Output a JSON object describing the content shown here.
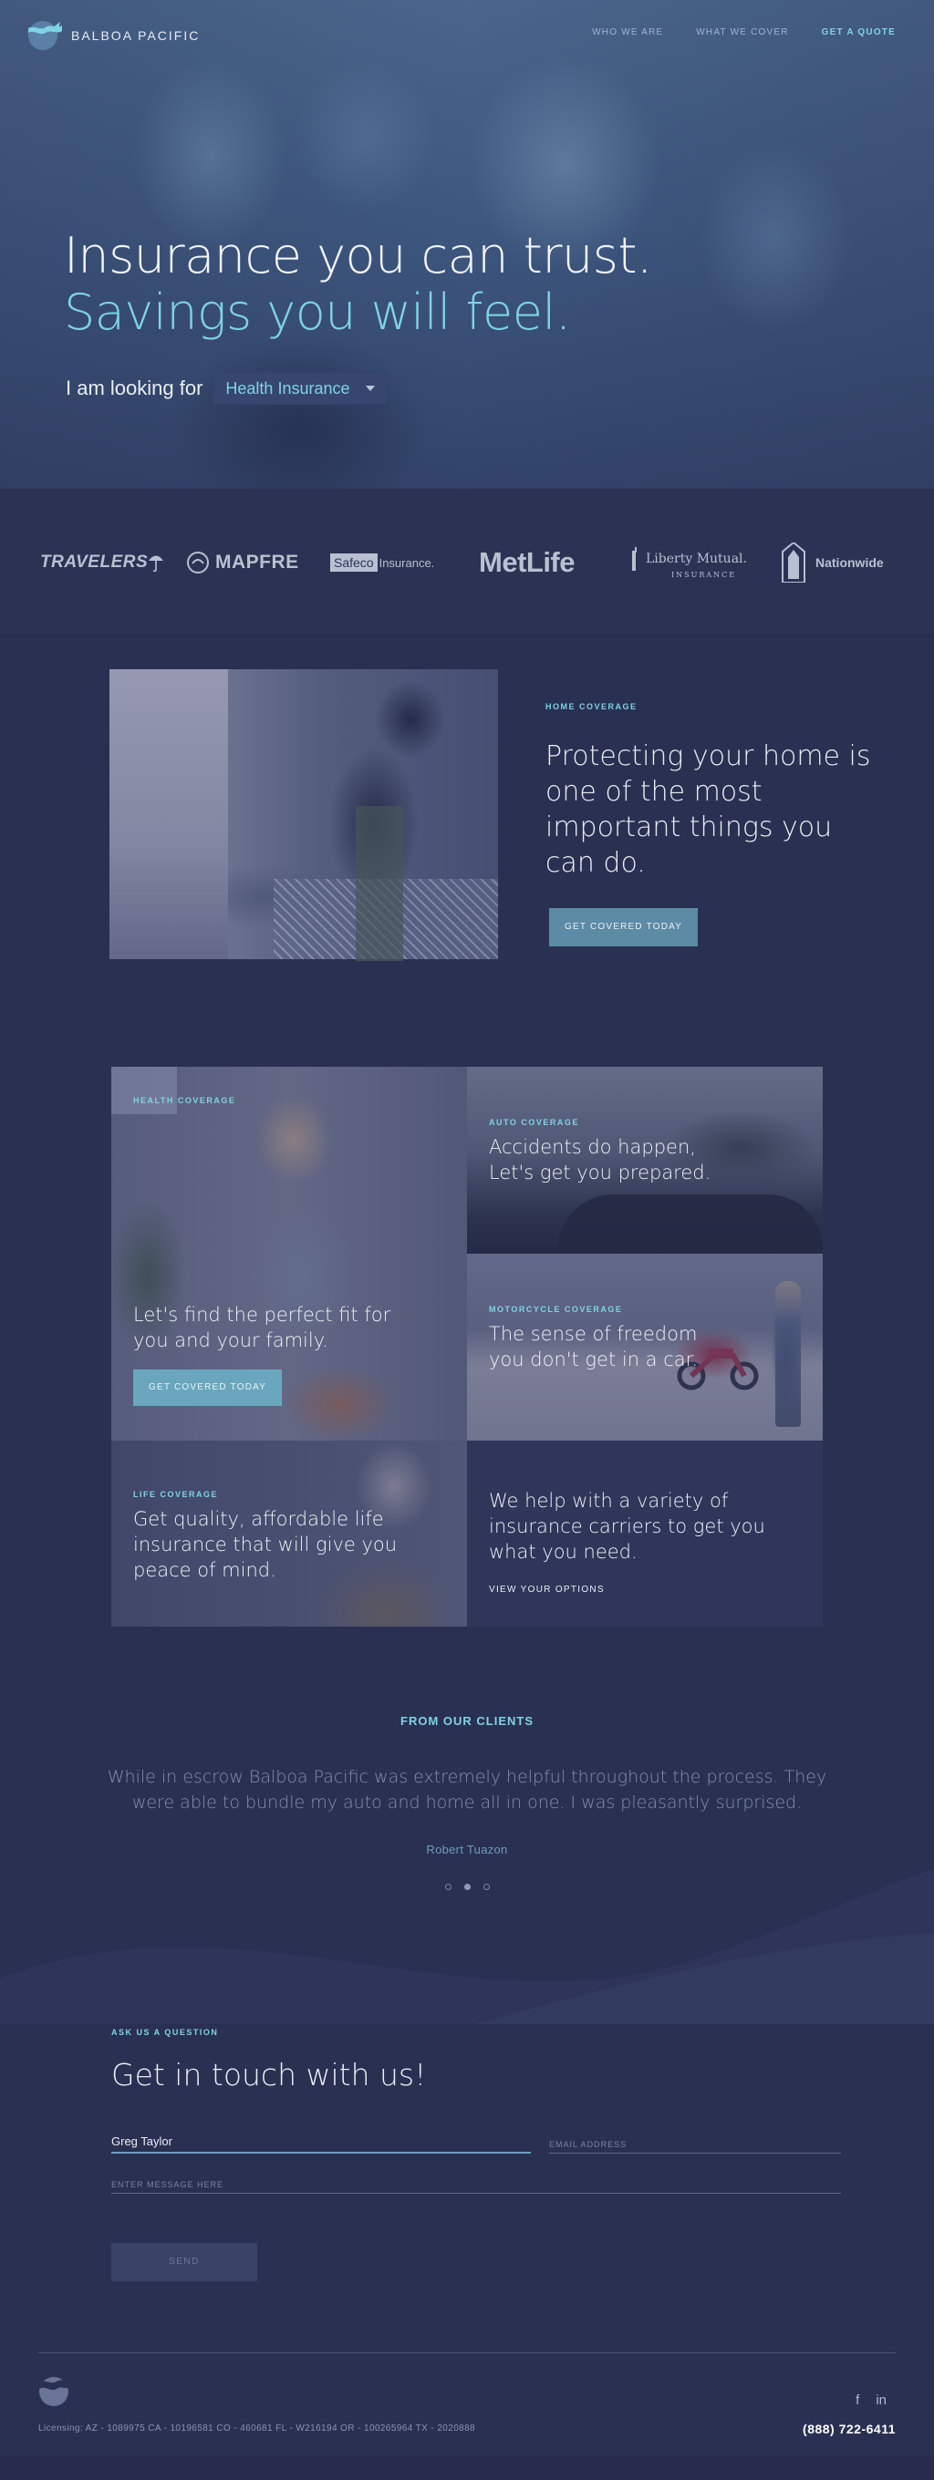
{
  "brand": {
    "name": "BALBOA PACIFIC",
    "accent": "#7fd3e4",
    "background": "#2a3051"
  },
  "nav": {
    "links": [
      {
        "label": "WHO WE ARE"
      },
      {
        "label": "WHAT WE COVER"
      },
      {
        "label": "GET A QUOTE"
      }
    ]
  },
  "hero": {
    "line1": "Insurance you can trust.",
    "line2": "Savings you will feel.",
    "looking_label": "I am looking for",
    "select_value": "Health Insurance"
  },
  "partners": {
    "travelers": "TRAVELERS",
    "mapfre": "MAPFRE",
    "safeco_box": "Safeco",
    "safeco_text": "Insurance.",
    "metlife": "MetLife",
    "liberty": "Liberty Mutual.",
    "liberty_sub": "INSURANCE",
    "nationwide": "Nationwide"
  },
  "home": {
    "eyebrow": "HOME COVERAGE",
    "title": "Protecting your home is one of the most important things you can do.",
    "button": "GET COVERED TODAY"
  },
  "coverage": {
    "health": {
      "eyebrow": "HEALTH COVERAGE",
      "title": "Let's find the perfect fit for you and your family.",
      "button": "GET COVERED TODAY"
    },
    "auto": {
      "eyebrow": "AUTO COVERAGE",
      "title": "Accidents do happen, Let's get you prepared."
    },
    "motorcycle": {
      "eyebrow": "MOTORCYCLE COVERAGE",
      "title": "The sense of freedom you don't get in a car."
    },
    "life": {
      "eyebrow": "LIFE COVERAGE",
      "title": "Get quality, affordable life insurance that will give you peace of mind."
    },
    "help": {
      "title": "We help with a variety of insurance carriers to get you what you need.",
      "link": "VIEW YOUR OPTIONS"
    }
  },
  "testimonial": {
    "eyebrow": "FROM OUR CLIENTS",
    "quote": "While in escrow Balboa Pacific was extremely helpful throughout the process. They were able to bundle my auto and home all in one. I was pleasantly surprised.",
    "author": "Robert Tuazon",
    "active_index": 1
  },
  "contact": {
    "eyebrow": "ASK US A QUESTION",
    "title": "Get in touch with us!",
    "name_value": "Greg Taylor",
    "email_placeholder": "EMAIL ADDRESS",
    "message_placeholder": "ENTER MESSAGE HERE",
    "send": "SEND"
  },
  "footer": {
    "license": "Licensing: AZ - 1089975 CA - 10196581 CO - 460681 FL - W216194 OR - 100265964 TX - 2020888",
    "social": [
      "facebook-icon",
      "linkedin-icon"
    ],
    "phone": "(888) 722-6411"
  }
}
